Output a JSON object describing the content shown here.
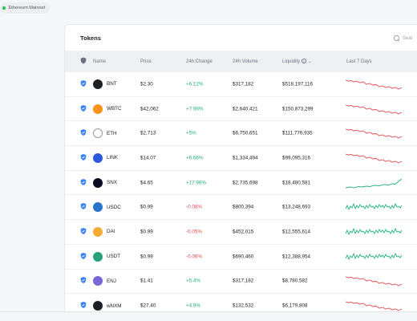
{
  "network": {
    "label": "Ethereum Mainnet",
    "status_color": "#22c55e"
  },
  "card": {
    "title": "Tokens"
  },
  "search": {
    "placeholder": "Sear"
  },
  "table": {
    "headers": {
      "name": "Name",
      "price": "Price",
      "change": "24h Change",
      "volume": "24h Volume",
      "liquidity": "Liquidity",
      "week": "Last 7 Days"
    },
    "rows": [
      {
        "symbol": "BNT",
        "price": "$2.30",
        "change": "+6.12%",
        "volume": "$317,182",
        "liquidity": "$518,197,116",
        "logo_color": "#1c1f24",
        "logo_icon": "bancor-icon",
        "trend": "down"
      },
      {
        "symbol": "WBTC",
        "price": "$42,062",
        "change": "+7.98%",
        "volume": "$2,640,421",
        "liquidity": "$150,873,299",
        "logo_color": "#f7931a",
        "logo_icon": "wbtc-icon",
        "trend": "down"
      },
      {
        "symbol": "ETH",
        "price": "$2,713",
        "change": "+5%",
        "volume": "$6,750,651",
        "liquidity": "$111,776,935",
        "logo_color": "#ffffff",
        "logo_icon": "ethereum-icon",
        "trend": "down"
      },
      {
        "symbol": "LINK",
        "price": "$14.07",
        "change": "+6.66%",
        "volume": "$1,334,494",
        "liquidity": "$99,095,316",
        "logo_color": "#2a5ada",
        "logo_icon": "chainlink-icon",
        "trend": "down"
      },
      {
        "symbol": "SNX",
        "price": "$4.65",
        "change": "+17.96%",
        "volume": "$2,735,698",
        "liquidity": "$18,480,581",
        "logo_color": "#0b0b22",
        "logo_icon": "synthetix-icon",
        "trend": "up"
      },
      {
        "symbol": "USDC",
        "price": "$0.99",
        "change": "-0.08%",
        "volume": "$800,394",
        "liquidity": "$13,248,693",
        "logo_color": "#2775ca",
        "logo_icon": "usdc-icon",
        "trend": "flat"
      },
      {
        "symbol": "DAI",
        "price": "$0.99",
        "change": "-0.05%",
        "volume": "$452,015",
        "liquidity": "$12,555,614",
        "logo_color": "#f5ac37",
        "logo_icon": "dai-icon",
        "trend": "flat"
      },
      {
        "symbol": "USDT",
        "price": "$0.99",
        "change": "-0.06%",
        "volume": "$690,460",
        "liquidity": "$12,388,954",
        "logo_color": "#26a17b",
        "logo_icon": "tether-icon",
        "trend": "flat"
      },
      {
        "symbol": "ENJ",
        "price": "$1.41",
        "change": "+5.4%",
        "volume": "$317,182",
        "liquidity": "$8,780,582",
        "logo_color": "#7866d5",
        "logo_icon": "enjin-icon",
        "trend": "down"
      },
      {
        "symbol": "wNXM",
        "price": "$27.40",
        "change": "+4.9%",
        "volume": "$132,532",
        "liquidity": "$6,179,808",
        "logo_color": "#1c1f24",
        "logo_icon": "wnxm-icon",
        "trend": "down"
      }
    ]
  },
  "colors": {
    "positive": "#22b07d",
    "negative": "#e5484d",
    "verified": "#3b82f6"
  }
}
